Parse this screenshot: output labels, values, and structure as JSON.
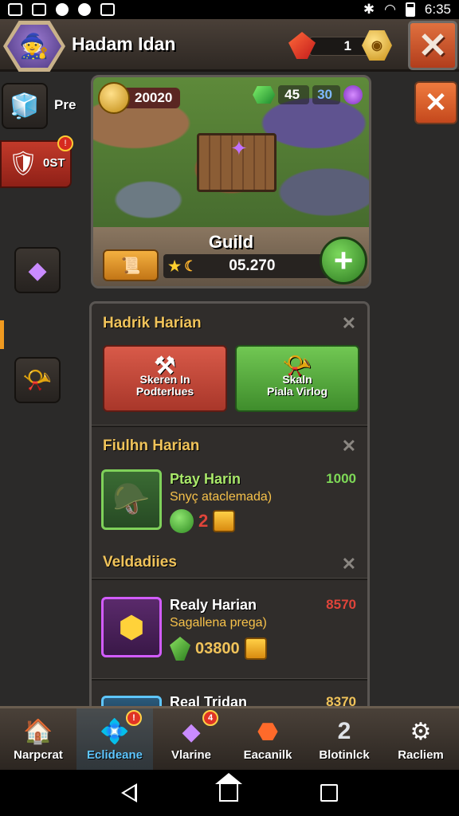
{
  "status_bar": {
    "time": "6:35"
  },
  "header": {
    "player_name": "Hadam Idan",
    "gem_count": "1"
  },
  "sidebar": {
    "item1_label": "Pre",
    "item2_label": "0ST"
  },
  "guild": {
    "coins": "20020",
    "emeralds": "45",
    "sapphires": "30",
    "title": "Guild",
    "score": "05.270"
  },
  "daily_section": {
    "title": "Hadrik Harian",
    "card1_line1": "Skeren In",
    "card1_line2": "Podterlues",
    "card2_line1": "Skaln",
    "card2_line2": "Piala Virlog"
  },
  "quest1_section": {
    "title": "Fiulhn Harian",
    "quest_name": "Ptay Harin",
    "quest_sub": "Snyç ataclemada)",
    "quest_reward": "1000",
    "reward_count": "2"
  },
  "quest2_section": {
    "title": "Veldadiies",
    "quest_name": "Realy Harian",
    "quest_sub": "Sagallena prega)",
    "quest_reward": "8570",
    "reward_value": "03800"
  },
  "quest3": {
    "quest_name": "Real Tridan",
    "quest_reward": "8370"
  },
  "bottom_nav": {
    "items": [
      {
        "label": "Narpcrat"
      },
      {
        "label": "Eclideane"
      },
      {
        "label": "Vlarine"
      },
      {
        "label": "Eacanilk"
      },
      {
        "label": "Blotinlck"
      },
      {
        "label": "Racliem"
      }
    ]
  },
  "colors": {
    "accent_gold": "#f0c35a",
    "reward_green": "#7ed957",
    "reward_red": "#e0443a",
    "active_tab": "#5ec6ff"
  }
}
